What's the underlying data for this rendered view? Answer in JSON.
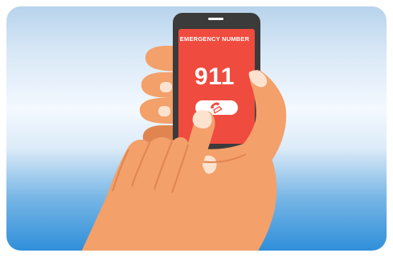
{
  "screen": {
    "title": "EMERGENCY NUMBER",
    "number": "911",
    "call_icon": "phone-handset-icon"
  },
  "colors": {
    "sky_top": "#b7d3ec",
    "sky_mid": "#f4f9ff",
    "sky_bottom": "#2f8fda",
    "phone_body": "#3b3b3b",
    "screen": "#ef4b3f",
    "skin": "#f3a06a",
    "skin_shadow": "#e18550",
    "nail": "#fde3cf"
  }
}
